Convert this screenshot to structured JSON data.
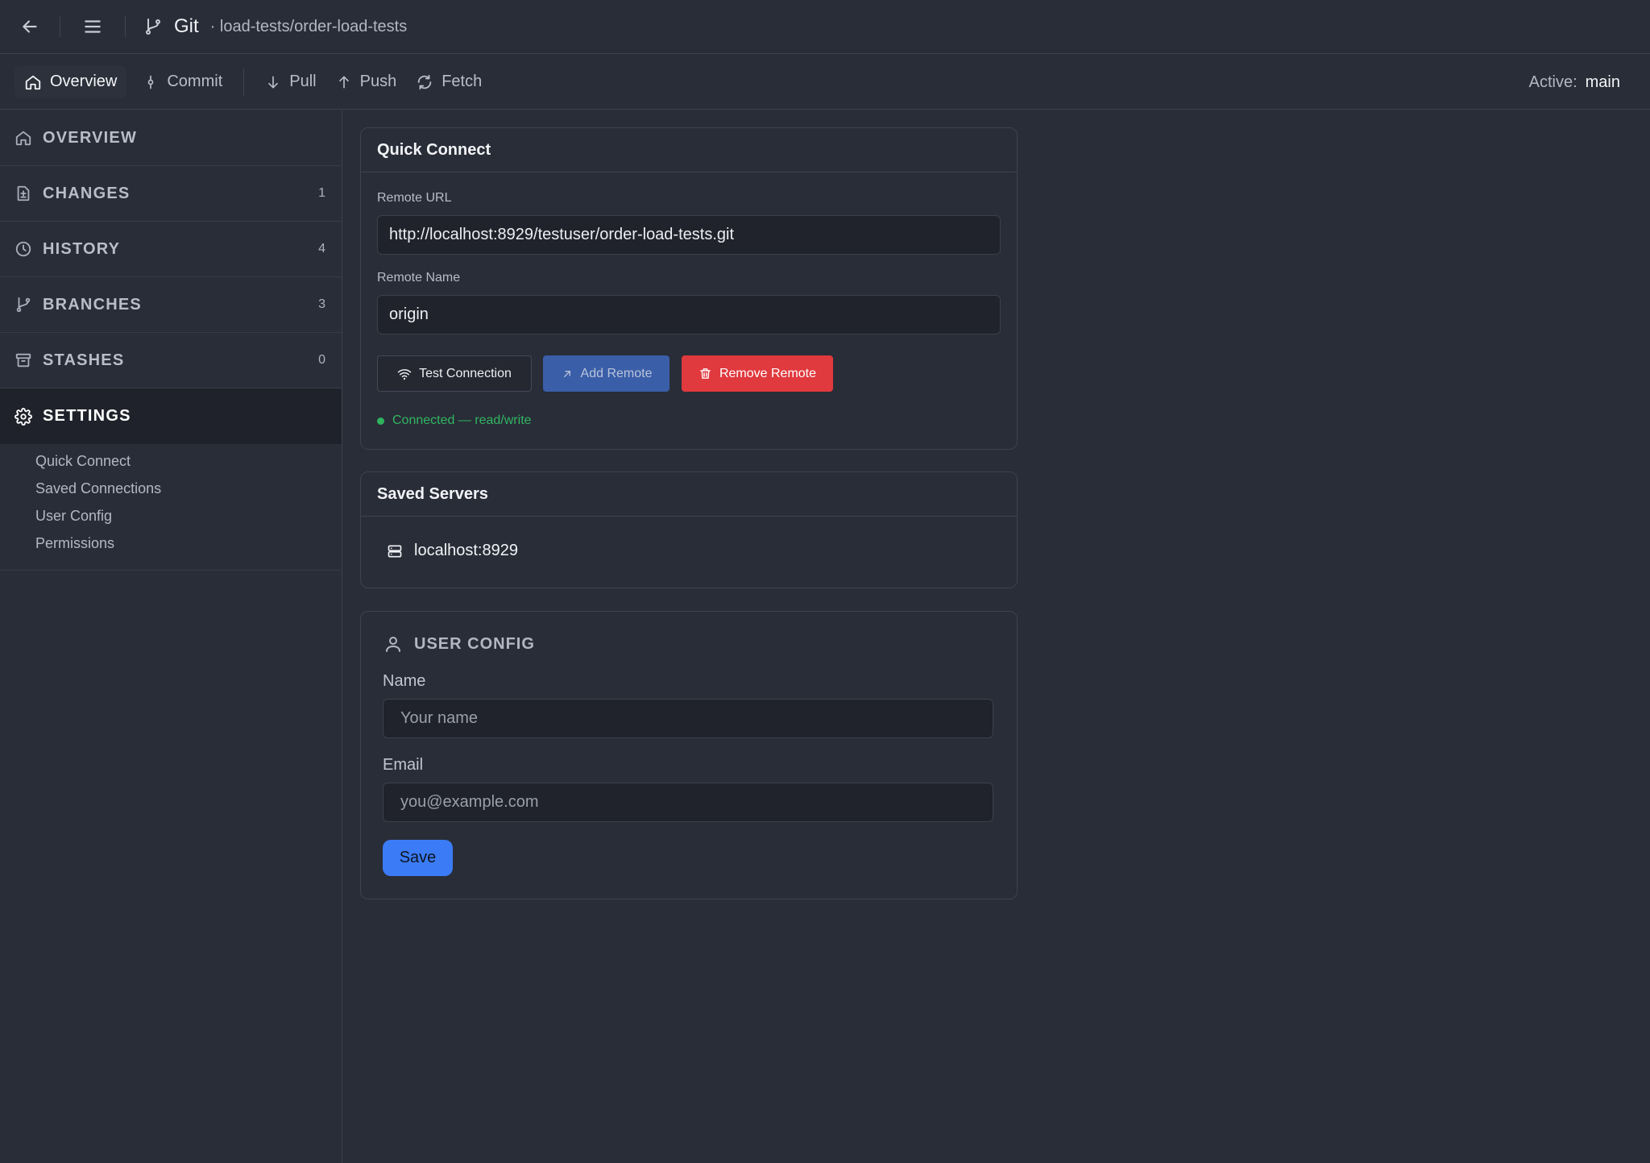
{
  "titlebar": {
    "app_title": "Git",
    "repo_path": "· load-tests/order-load-tests",
    "back_icon": "arrow-left-icon",
    "menu_icon": "hamburger-menu-icon",
    "git_icon": "git-branch-icon"
  },
  "toolbar": {
    "items": [
      {
        "label": "Overview",
        "icon": "home-icon",
        "active": true
      },
      {
        "label": "Commit",
        "icon": "git-commit-icon"
      },
      {
        "label": "Pull",
        "icon": "arrow-down-icon"
      },
      {
        "label": "Push",
        "icon": "arrow-up-icon"
      },
      {
        "label": "Fetch",
        "icon": "refresh-icon"
      }
    ],
    "active_label": "Active:",
    "active_branch": "main"
  },
  "sidebar": {
    "items": [
      {
        "label": "OVERVIEW",
        "icon": "home-icon",
        "count": ""
      },
      {
        "label": "CHANGES",
        "icon": "file-diff-icon",
        "count": "1"
      },
      {
        "label": "HISTORY",
        "icon": "clock-icon",
        "count": "4"
      },
      {
        "label": "BRANCHES",
        "icon": "git-branch-icon",
        "count": "3"
      },
      {
        "label": "STASHES",
        "icon": "archive-icon",
        "count": "0"
      },
      {
        "label": "SETTINGS",
        "icon": "gear-icon",
        "count": "",
        "active": true
      }
    ],
    "settings_subitems": [
      "Quick Connect",
      "Saved Connections",
      "User Config",
      "Permissions"
    ]
  },
  "quick_connect": {
    "title": "Quick Connect",
    "remote_url_label": "Remote URL",
    "remote_url_value": "http://localhost:8929/testuser/order-load-tests.git",
    "remote_name_label": "Remote Name",
    "remote_name_value": "origin",
    "test_button": "Test Connection",
    "add_button": "Add Remote",
    "remove_button": "Remove Remote",
    "status": "Connected — read/write",
    "colors": {
      "status": "#31b560",
      "add": "#3a5ea8",
      "remove": "#e0393e"
    }
  },
  "saved_servers": {
    "title": "Saved Servers",
    "servers": [
      "localhost:8929"
    ]
  },
  "user_config": {
    "title": "USER CONFIG",
    "name_label": "Name",
    "name_placeholder": "Your name",
    "email_label": "Email",
    "email_placeholder": "you@example.com",
    "save_button": "Save",
    "colors": {
      "save": "#3b7cf6"
    }
  }
}
